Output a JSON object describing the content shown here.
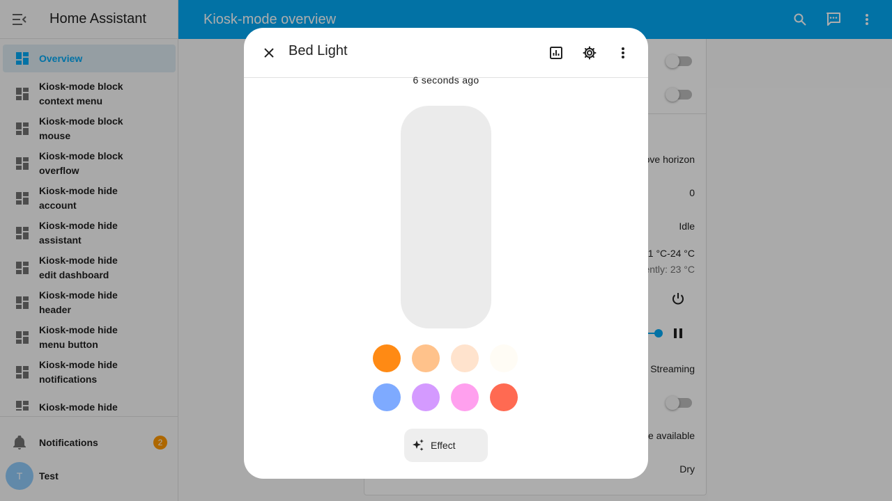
{
  "app": {
    "title": "Home Assistant"
  },
  "sidebar": {
    "items": [
      {
        "label": "Overview",
        "active": true
      },
      {
        "label": "Kiosk-mode block",
        "label2": "context menu"
      },
      {
        "label": "Kiosk-mode block",
        "label2": "mouse"
      },
      {
        "label": "Kiosk-mode block",
        "label2": "overflow"
      },
      {
        "label": "Kiosk-mode hide",
        "label2": "account"
      },
      {
        "label": "Kiosk-mode hide",
        "label2": "assistant"
      },
      {
        "label": "Kiosk-mode hide",
        "label2": "edit dashboard"
      },
      {
        "label": "Kiosk-mode hide",
        "label2": "header"
      },
      {
        "label": "Kiosk-mode hide",
        "label2": "menu button"
      },
      {
        "label": "Kiosk-mode hide",
        "label2": "notifications"
      },
      {
        "label": "Kiosk-mode hide",
        "label2": ""
      }
    ],
    "notifications": {
      "label": "Notifications",
      "count": "2"
    },
    "user": {
      "name": "Test",
      "initial": "T"
    }
  },
  "header": {
    "title": "Kiosk-mode overview"
  },
  "background_card": {
    "row_above_horizon": "ove horizon",
    "row_zero": "0",
    "row_idle": "Idle",
    "row_temp_range": "21 °C-24 °C",
    "row_temp_current": "ently: 23 °C",
    "row_streaming": "Streaming",
    "row_update": "te available",
    "row_dry": "Dry"
  },
  "dialog": {
    "title": "Bed Light",
    "last_changed": "6 seconds ago",
    "effect_label": "Effect",
    "brightness_level": 0
  },
  "colors": {
    "primary": "#03a9f4",
    "swatches": [
      "#ff8a14",
      "#ffc28b",
      "#ffe3cd",
      "#fffcf5",
      "#7eaaff",
      "#d49aff",
      "#ffa0ee",
      "#ff6a52"
    ]
  }
}
